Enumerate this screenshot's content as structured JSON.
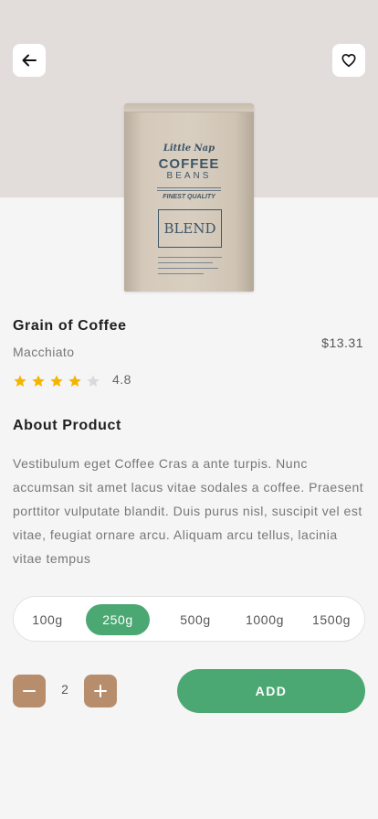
{
  "header": {
    "back_icon": "arrow-left-icon",
    "favorite_icon": "heart-outline-icon",
    "background_color": "#e2dddb"
  },
  "product_image": {
    "brand": "Little Nap",
    "line1": "COFFEE",
    "line2": "BEANS",
    "tagline": "FINEST QUALITY",
    "label": "BLEND"
  },
  "product": {
    "name": "Grain of Coffee",
    "variant": "Macchiato",
    "price": "$13.31",
    "rating": "4.8",
    "stars_filled": 4,
    "stars_total": 5,
    "star_color": "#f5b400"
  },
  "about": {
    "title": "About Product",
    "text": "Vestibulum eget Coffee Cras a ante turpis. Nunc accumsan sit amet lacus vitae sodales a coffee. Praesent porttitor vulputate blandit. Duis purus nisl, suscipit vel est vitae, feugiat ornare arcu. Aliquam arcu tellus, lacinia vitae tempus"
  },
  "sizes": {
    "options": [
      "100g",
      "250g",
      "500g",
      "1000g",
      "1500g"
    ],
    "selected": "250g"
  },
  "cart": {
    "minus_icon": "minus-icon",
    "plus_icon": "plus-icon",
    "quantity": "2",
    "add_label": "ADD"
  },
  "colors": {
    "accent_green": "#4ca873",
    "stepper_brown": "#b88d6c"
  }
}
